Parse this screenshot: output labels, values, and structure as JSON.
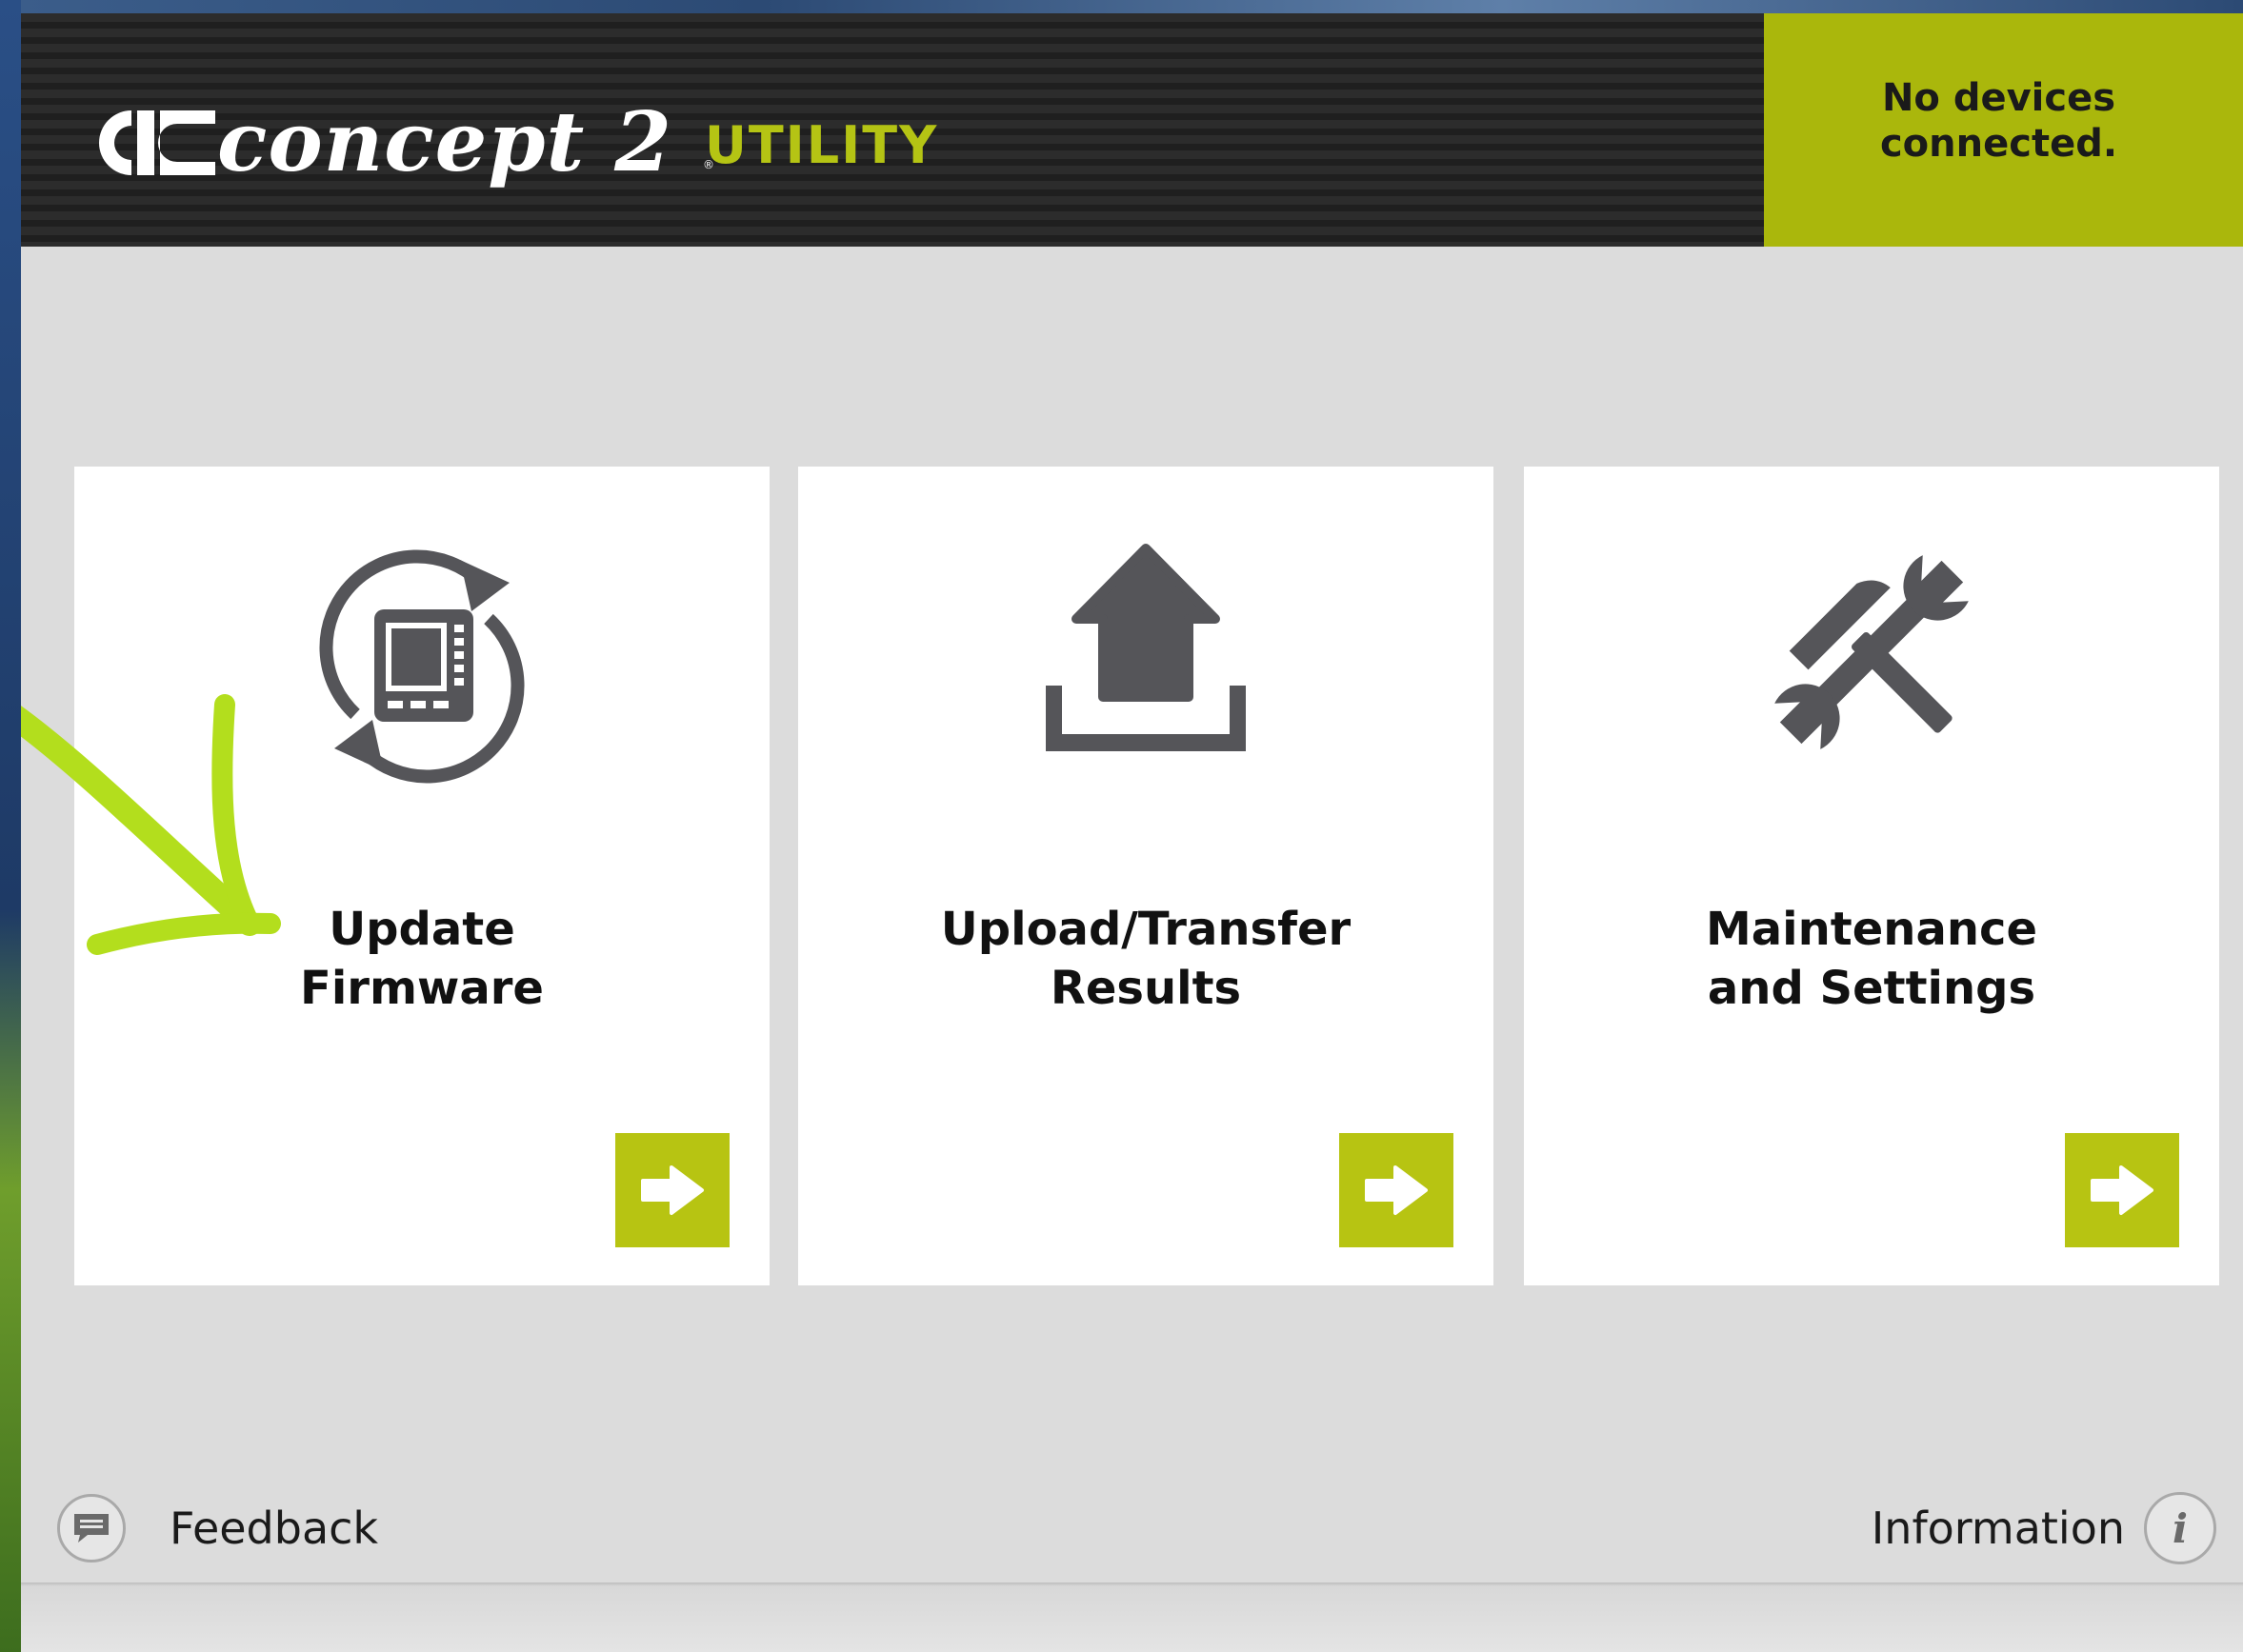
{
  "header": {
    "brand": "concept 2",
    "product": "UTILITY",
    "status": "No devices connected."
  },
  "cards": [
    {
      "label": "Update\nFirmware",
      "icon": "sync-monitor-icon",
      "action_icon": "arrow-right-icon"
    },
    {
      "label": "Upload/Transfer\nResults",
      "icon": "upload-icon",
      "action_icon": "arrow-right-icon"
    },
    {
      "label": "Maintenance\nand Settings",
      "icon": "tools-icon",
      "action_icon": "arrow-right-icon"
    }
  ],
  "footer": {
    "feedback_label": "Feedback",
    "information_label": "Information",
    "information_glyph": "i"
  },
  "colors": {
    "accent": "#b7c412",
    "header_dark": "#2a2a2a",
    "panel_bg": "#dcdcdc",
    "icon_gray": "#555559"
  }
}
